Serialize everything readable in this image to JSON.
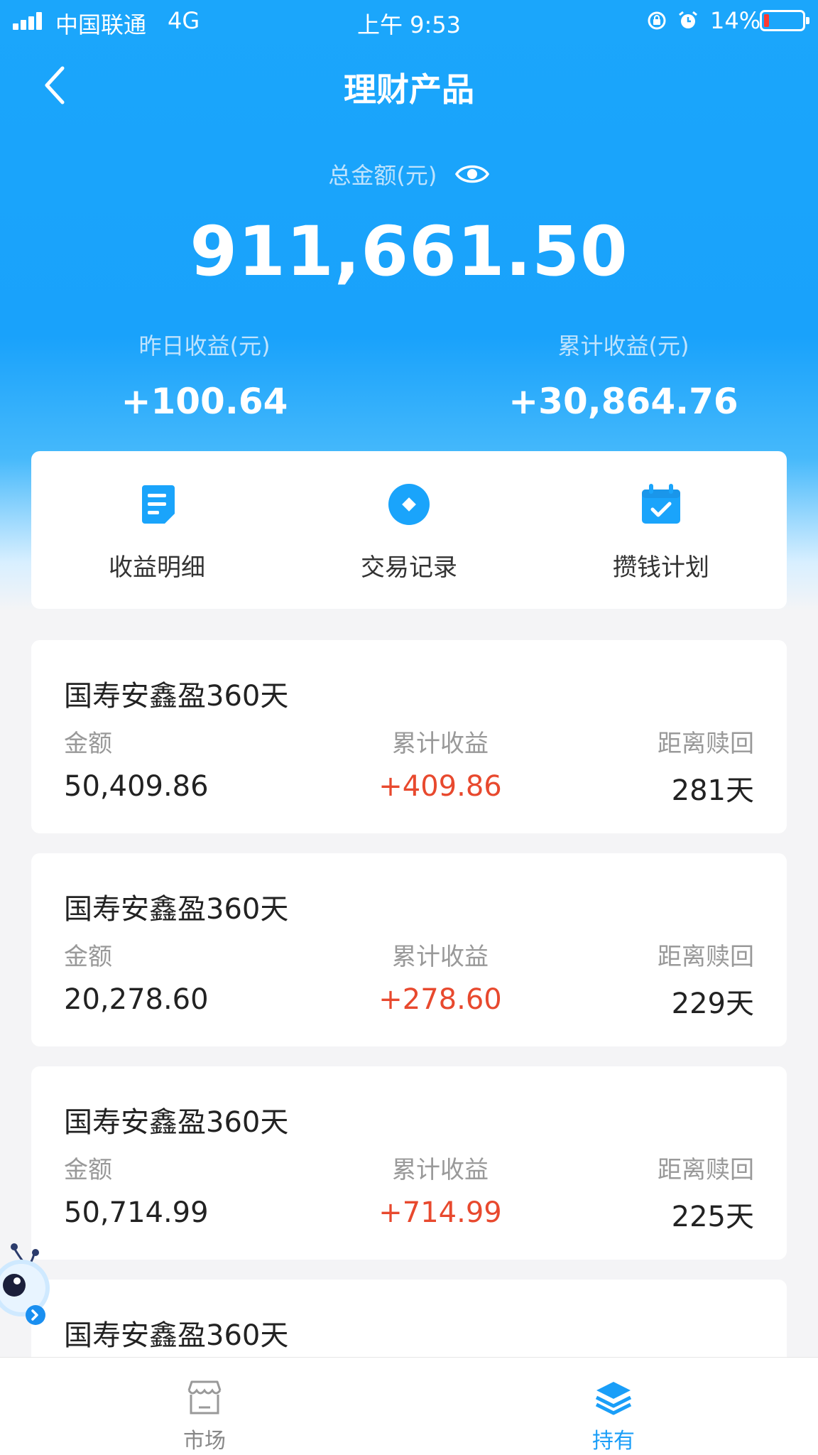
{
  "status_bar": {
    "carrier": "中国联通",
    "network": "4G",
    "time": "上午 9:53",
    "battery": "14%",
    "battery_color": "#ff3b30"
  },
  "nav": {
    "title": "理财产品",
    "back_icon": "chevron-left-icon"
  },
  "summary": {
    "total_label": "总金额(元)",
    "total_value": "911,661.50",
    "eye_icon": "eye-icon",
    "yesterday_label": "昨日收益(元)",
    "yesterday_value": "+100.64",
    "cumulative_label": "累计收益(元)",
    "cumulative_value": "+30,864.76"
  },
  "actions": [
    {
      "label": "收益明细",
      "icon": "document-icon"
    },
    {
      "label": "交易记录",
      "icon": "record-icon"
    },
    {
      "label": "攒钱计划",
      "icon": "calendar-check-icon"
    }
  ],
  "products": [
    {
      "name": "国寿安鑫盈360天",
      "amount_label": "金额",
      "amount": "50,409.86",
      "profit_label": "累计收益",
      "profit": "+409.86",
      "days_label": "距离赎回",
      "days": "281天"
    },
    {
      "name": "国寿安鑫盈360天",
      "amount_label": "金额",
      "amount": "20,278.60",
      "profit_label": "累计收益",
      "profit": "+278.60",
      "days_label": "距离赎回",
      "days": "229天"
    },
    {
      "name": "国寿安鑫盈360天",
      "amount_label": "金额",
      "amount": "50,714.99",
      "profit_label": "累计收益",
      "profit": "+714.99",
      "days_label": "距离赎回",
      "days": "225天"
    },
    {
      "name": "国寿安鑫盈360天"
    }
  ],
  "tabs": [
    {
      "label": "市场",
      "icon": "store-icon"
    },
    {
      "label": "持有",
      "icon": "layers-icon"
    }
  ],
  "colors": {
    "brand_blue": "#1aa4fb",
    "profit_red": "#e8492e",
    "tab_active": "#1a9ef8"
  }
}
